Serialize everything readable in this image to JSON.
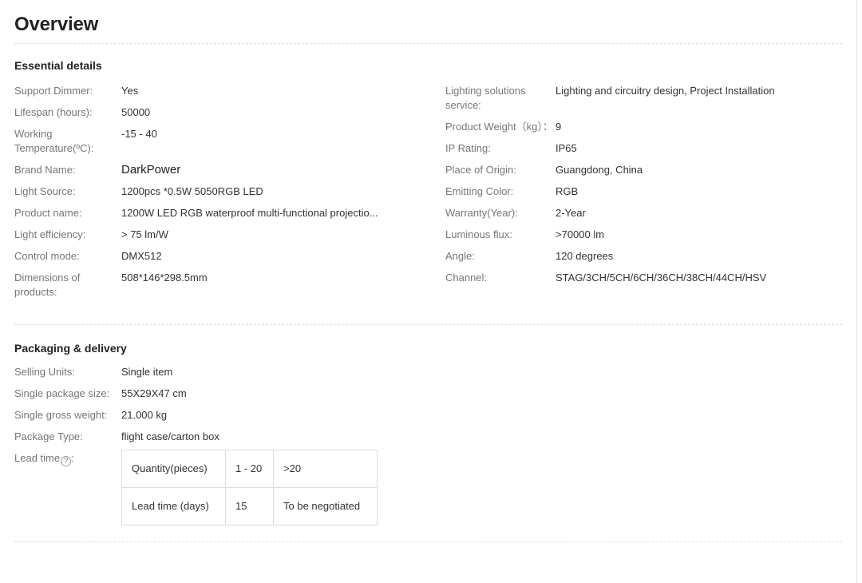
{
  "page": {
    "title": "Overview"
  },
  "sections": {
    "essential": {
      "heading": "Essential details",
      "left_rows": [
        {
          "label": "Support Dimmer:",
          "value": "Yes"
        },
        {
          "label": "Lifespan (hours):",
          "value": "50000"
        },
        {
          "label": "Working Temperature(ºC):",
          "value": "-15 - 40"
        },
        {
          "label": "Brand Name:",
          "value": "DarkPower"
        },
        {
          "label": "Light Source:",
          "value": "1200pcs *0.5W 5050RGB LED"
        },
        {
          "label": "Product name:",
          "value": "1200W LED RGB waterproof multi-functional projectio..."
        },
        {
          "label": "Light efficiency:",
          "value": "> 75 lm/W"
        },
        {
          "label": "Control mode:",
          "value": "DMX512"
        },
        {
          "label": "Dimensions of products:",
          "value": "508*146*298.5mm"
        }
      ],
      "right_rows": [
        {
          "label": "Lighting solutions service:",
          "value": "Lighting and circuitry design, Project Installation"
        },
        {
          "label": "Product Weight（kg）：",
          "value": "9"
        },
        {
          "label": "IP Rating:",
          "value": "IP65"
        },
        {
          "label": "Place of Origin:",
          "value": "Guangdong, China"
        },
        {
          "label": "Emitting Color:",
          "value": "RGB"
        },
        {
          "label": "Warranty(Year):",
          "value": "2-Year"
        },
        {
          "label": "Luminous flux:",
          "value": ">70000 lm"
        },
        {
          "label": "Angle:",
          "value": "120 degrees"
        },
        {
          "label": "Channel:",
          "value": "STAG/3CH/5CH/6CH/36CH/38CH/44CH/HSV"
        }
      ]
    },
    "packaging": {
      "heading": "Packaging & delivery",
      "rows": [
        {
          "label": "Selling Units:",
          "value": "Single item"
        },
        {
          "label": "Single package size:",
          "value": "55X29X47 cm"
        },
        {
          "label": "Single gross weight:",
          "value": "21.000 kg"
        },
        {
          "label": "Package Type:",
          "value": "flight case/carton box"
        }
      ],
      "lead_time": {
        "label": "Lead time",
        "label_suffix": ":",
        "help_icon": "question-mark-circle-icon",
        "help_glyph": "?",
        "table": {
          "rows": [
            [
              "Quantity(pieces)",
              "1 - 20",
              ">20"
            ],
            [
              "Lead time (days)",
              "15",
              "To be negotiated"
            ]
          ]
        }
      }
    }
  },
  "colors": {
    "label_text": "#767676",
    "value_text": "#333333",
    "heading_text": "#222222",
    "divider": "#dddddd",
    "table_border": "#dcdcdc",
    "page_background": "#ffffff"
  }
}
